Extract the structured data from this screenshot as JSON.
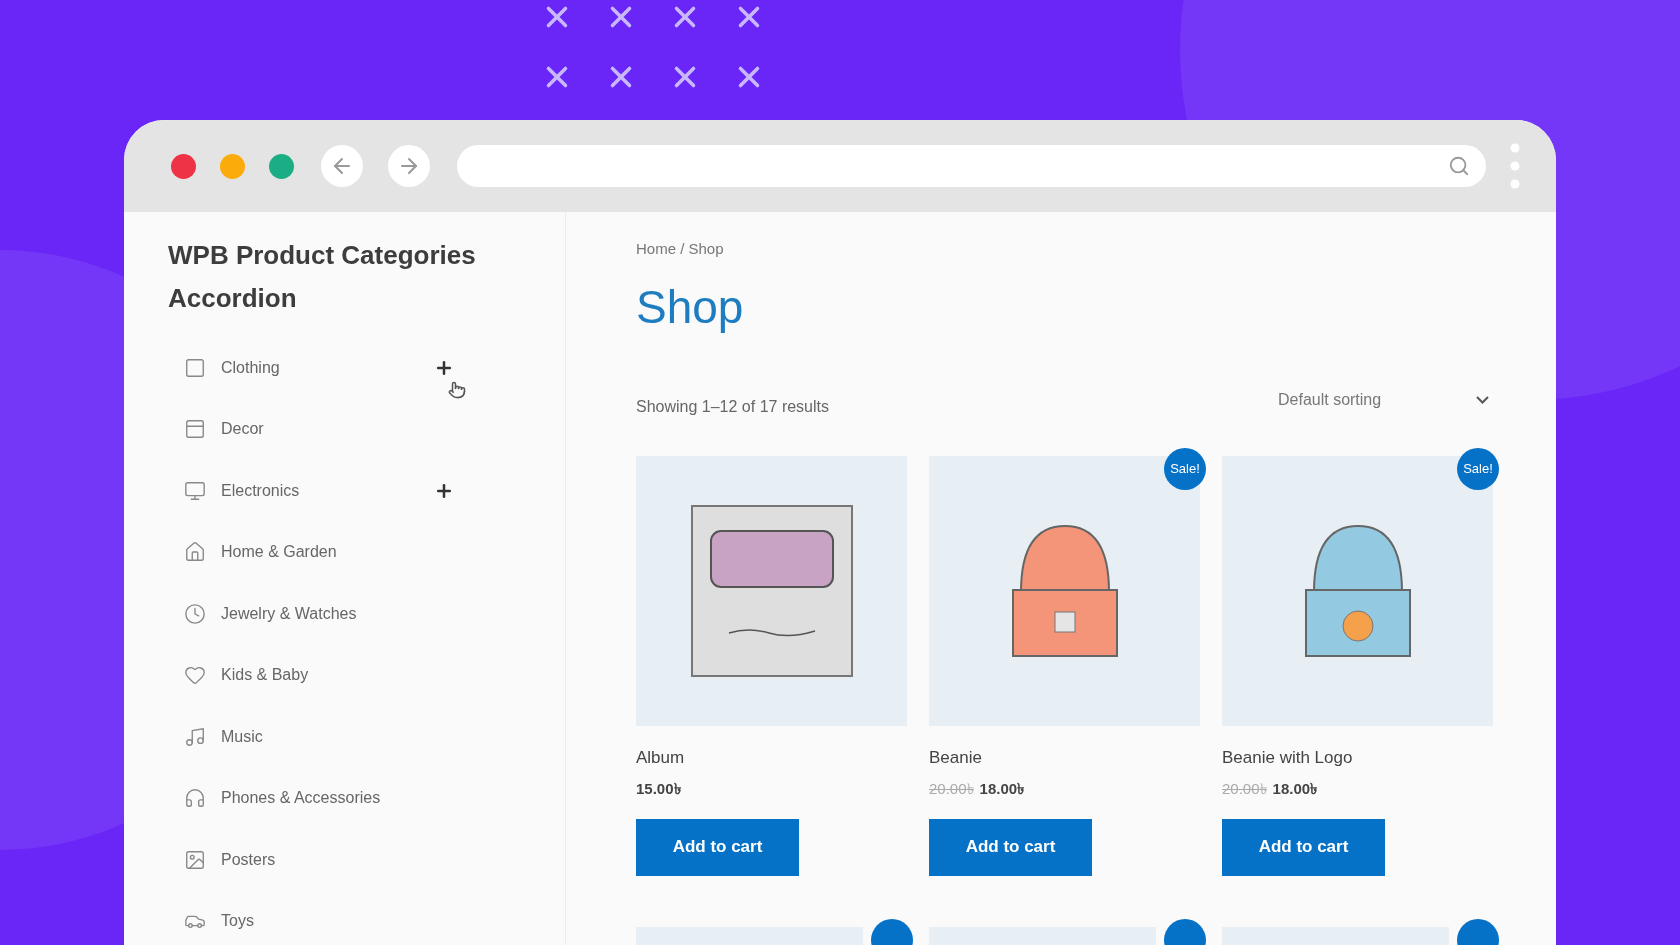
{
  "sidebar": {
    "title": "WPB Product Categories Accordion",
    "categories": [
      {
        "label": "Clothing",
        "expandable": true
      },
      {
        "label": "Decor",
        "expandable": false
      },
      {
        "label": "Electronics",
        "expandable": true
      },
      {
        "label": "Home & Garden",
        "expandable": false
      },
      {
        "label": "Jewelry & Watches",
        "expandable": false
      },
      {
        "label": "Kids & Baby",
        "expandable": false
      },
      {
        "label": "Music",
        "expandable": false
      },
      {
        "label": "Phones & Accessories",
        "expandable": false
      },
      {
        "label": "Posters",
        "expandable": false
      },
      {
        "label": "Toys",
        "expandable": false
      }
    ]
  },
  "breadcrumb": "Home / Shop",
  "page_title": "Shop",
  "result_count": "Showing 1–12 of 17 results",
  "sorting": {
    "value": "Default sorting"
  },
  "products": [
    {
      "name": "Album",
      "kind": "album",
      "price": "15.00৳",
      "button": "Add to cart"
    },
    {
      "name": "Beanie",
      "kind": "beanie",
      "sale_badge": "Sale!",
      "regular_price": "20.00৳",
      "price": "18.00৳",
      "button": "Add to cart"
    },
    {
      "name": "Beanie with Logo",
      "kind": "beanie-logo",
      "sale_badge": "Sale!",
      "regular_price": "20.00৳",
      "price": "18.00৳",
      "button": "Add to cart"
    }
  ],
  "next_row": [
    {
      "on_sale": true
    },
    {
      "on_sale": true
    },
    {
      "on_sale": true
    }
  ]
}
